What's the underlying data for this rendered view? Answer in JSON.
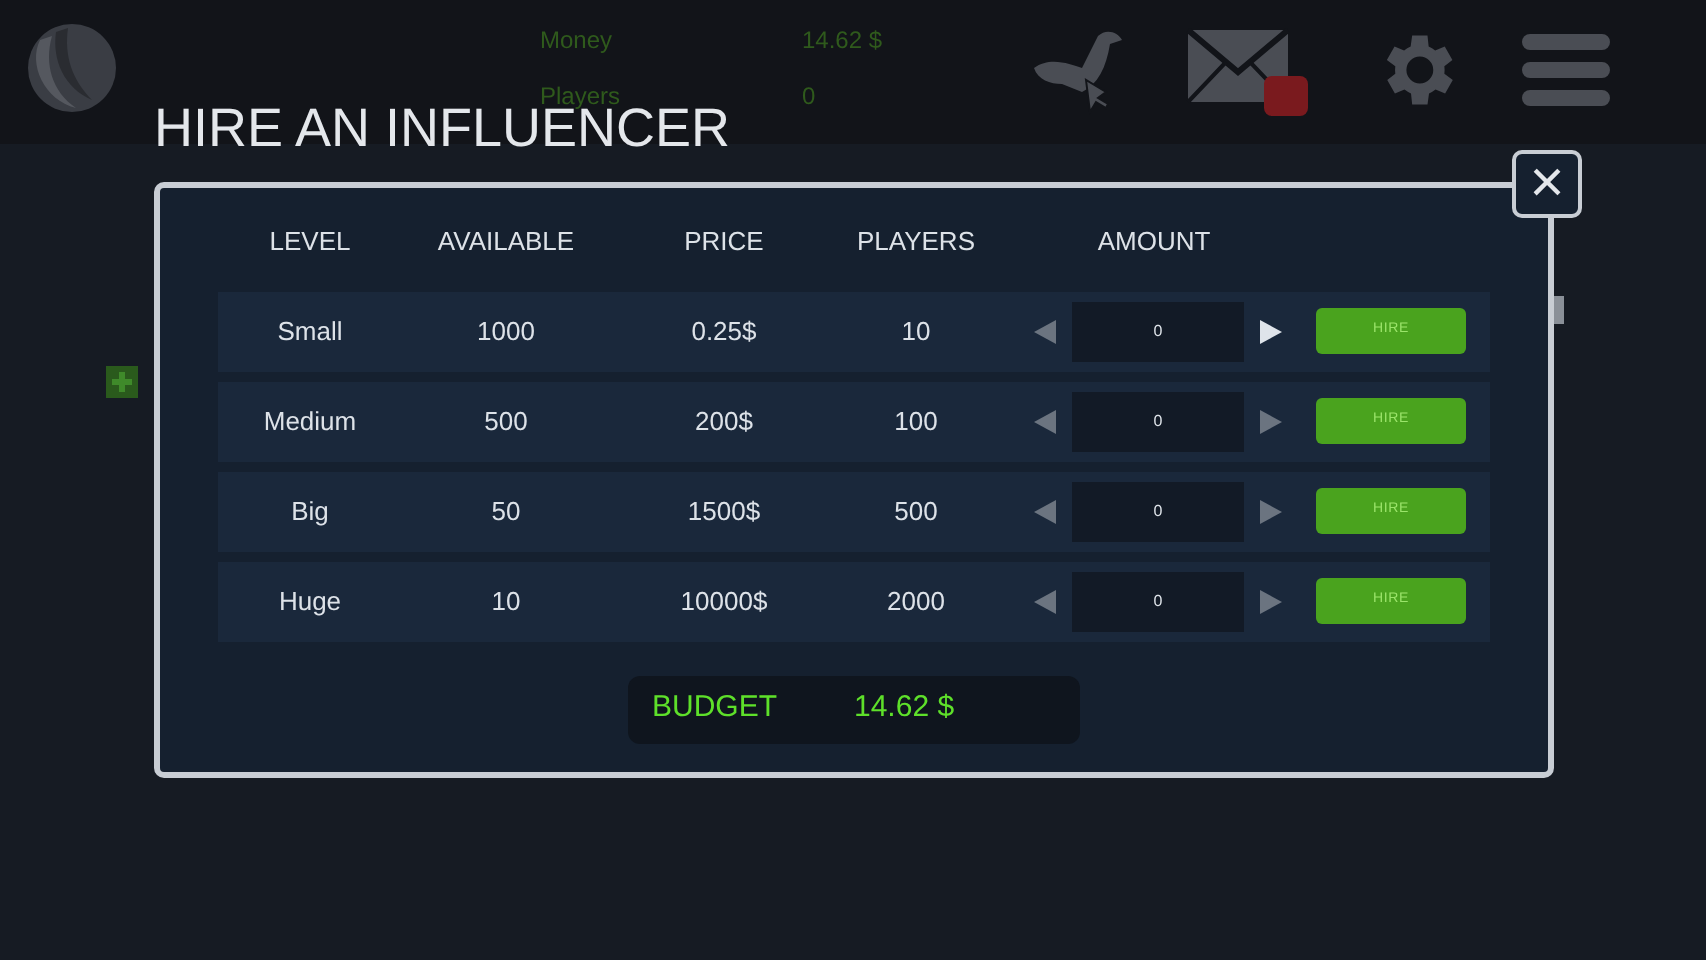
{
  "stats": [
    {
      "label": "Money",
      "value": "14.62 $"
    },
    {
      "label": "Players",
      "value": "0"
    }
  ],
  "mail": {
    "unread": true
  },
  "dialog": {
    "title": "HIRE AN INFLUENCER",
    "close": "×",
    "columns": [
      "LEVEL",
      "AVAILABLE",
      "PRICE",
      "PLAYERS",
      "AMOUNT"
    ],
    "rows": [
      {
        "level": "Small",
        "available": "1000",
        "price": "0.25$",
        "players": "10",
        "amount": "0",
        "can_decrease": false,
        "can_increase": true,
        "button": "HIRE"
      },
      {
        "level": "Medium",
        "available": "500",
        "price": "200$",
        "players": "100",
        "amount": "0",
        "can_decrease": false,
        "can_increase": false,
        "button": "HIRE"
      },
      {
        "level": "Big",
        "available": "50",
        "price": "1500$",
        "players": "500",
        "amount": "0",
        "can_decrease": false,
        "can_increase": false,
        "button": "HIRE"
      },
      {
        "level": "Huge",
        "available": "10",
        "price": "10000$",
        "players": "2000",
        "amount": "0",
        "can_decrease": false,
        "can_increase": false,
        "button": "HIRE"
      }
    ],
    "budget": {
      "label": "BUDGET",
      "value": "14.62 $"
    }
  }
}
